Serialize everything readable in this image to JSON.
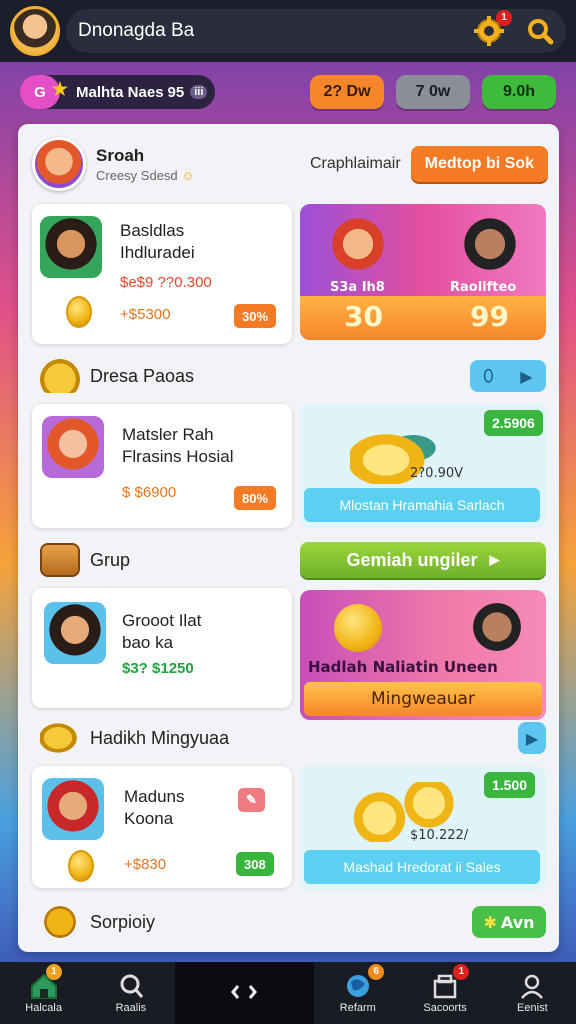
{
  "header": {
    "title": "Dnonagda Ba",
    "settings_badge": "1"
  },
  "currency": {
    "level": "G",
    "player_name": "Malhta Naes",
    "player_number": "95",
    "player_tag": "iii",
    "buttons": [
      "2? Dw",
      "7 0w",
      "9.0h"
    ]
  },
  "profile": {
    "name": "Sroah",
    "subtitle": "Creesy Sdesd",
    "right_label": "Craphlaimair",
    "action_button": "Medtop bi Sok"
  },
  "cards": [
    {
      "title_line1": "Basldlas",
      "title_line2": "Ihdluradei",
      "price_top": "$e$9 ??0.300",
      "price_bottom": "+$5300",
      "tag": "30%",
      "promo_left_label": "S3a Ih8",
      "promo_left_value": "30",
      "promo_right_label": "Raolifteo",
      "promo_right_value": "99"
    },
    {
      "title_line1": "Matsler Rah",
      "title_line2": "Flrasins Hosial",
      "price": "$ $6900",
      "tag": "80%",
      "promo_chip": "2.5906",
      "promo_caption": "2?0.90V",
      "promo_bar": "Mlostan Hramahia Sarlach"
    },
    {
      "title_line1": "Grooot Ilat",
      "title_line2": "bao ka",
      "price": "$3? $1250",
      "promo_title": "Hadlah Naliatin Uneen",
      "promo_bar": "Mingweauar"
    },
    {
      "title_line1": "Maduns",
      "title_line2": "Koona",
      "price": "+$830",
      "tag": "308",
      "promo_chip": "1.500",
      "promo_caption": "$10.222/",
      "promo_bar": "Mashad Hredorat ii Sales"
    }
  ],
  "sections": {
    "s1": "Dresa Paoas",
    "s2": "Grup",
    "s2_action": "Gemiah ungiler",
    "s3": "Hadikh Mingyuaa",
    "s4": "Sorpioiy",
    "s4_action": "Avn"
  },
  "nav": {
    "items": [
      "Halcala",
      "Raalis",
      "",
      "Refarm",
      "Sacoorts",
      "Eenist"
    ],
    "badges": [
      "1",
      "",
      "",
      "6",
      "1",
      ""
    ]
  },
  "colors": {
    "accent_orange": "#f57a24",
    "accent_green": "#39b63e",
    "accent_cyan": "#5bd0f0",
    "topbar": "#1c1f2b"
  }
}
